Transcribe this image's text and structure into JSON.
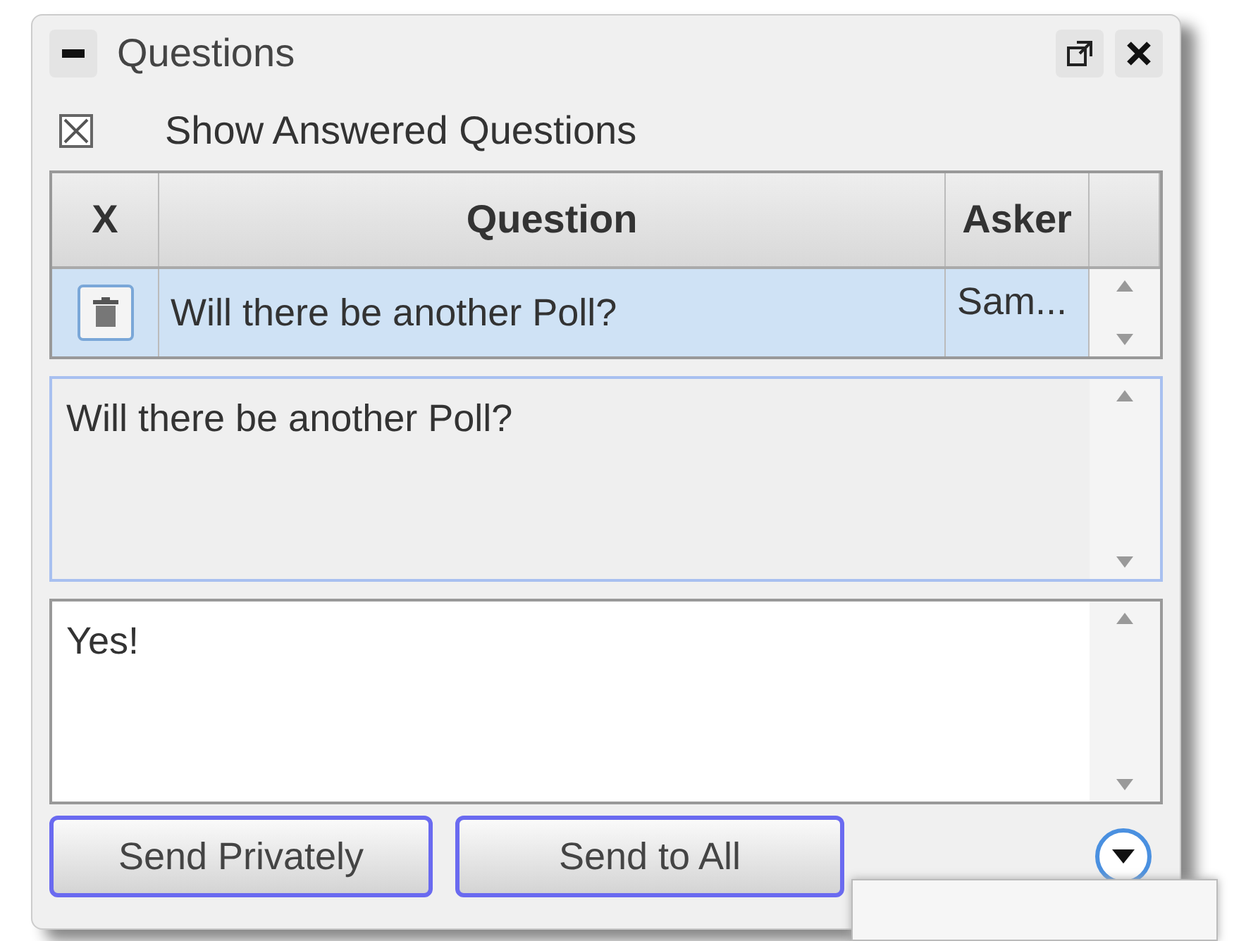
{
  "window": {
    "title": "Questions"
  },
  "show_answered": {
    "label": "Show Answered Questions",
    "checked": true
  },
  "table": {
    "columns": [
      "X",
      "Question",
      "Asker"
    ],
    "rows": [
      {
        "question": "Will there be another Poll?",
        "asker": "Sam...",
        "selected": true
      }
    ]
  },
  "question_text": "Will there be another Poll?",
  "answer_text": "Yes!",
  "buttons": [
    "Send Privately",
    "Send to All"
  ]
}
